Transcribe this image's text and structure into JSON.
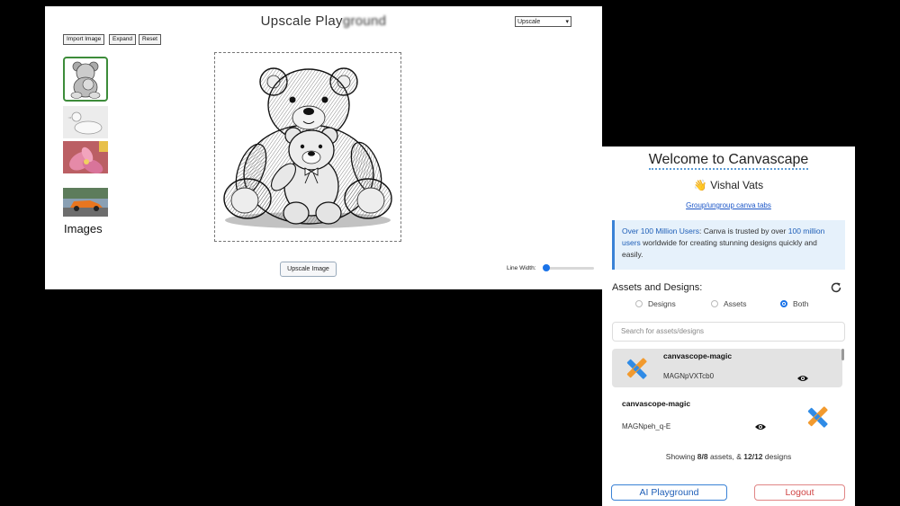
{
  "playground": {
    "title_main": "Upscale Play",
    "title_blur": "ground",
    "mode_select": "Upscale",
    "buttons": {
      "import": "Import Image",
      "expand": "Expand",
      "reset": "Reset"
    },
    "images_label": "Images",
    "upscale_button": "Upscale Image",
    "line_width_label": "Line Width:",
    "line_width_value": 0.0
  },
  "panel": {
    "welcome": "Welcome to Canvascape",
    "user_emoji": "👋",
    "user_name": "Vishal Vats",
    "group_link": "Group/ungroup canva tabs",
    "info": {
      "lead": "Over 100 Million Users",
      "text1": ": Canva is trusted by over ",
      "highlight": "100 million users",
      "text2": " worldwide for creating stunning designs quickly and easily."
    },
    "assets_title": "Assets and Designs:",
    "filters": [
      "Designs",
      "Assets",
      "Both"
    ],
    "selected_filter": "Both",
    "search_placeholder": "Search for assets/designs",
    "items": [
      {
        "name": "canvascope-magic",
        "id": "MAGNpVXTcb0"
      },
      {
        "name": "canvascope-magic",
        "id": "MAGNpeh_q-E"
      }
    ],
    "showing": {
      "prefix": "Showing ",
      "assets": "8/8",
      "mid": " assets, & ",
      "designs": "12/12",
      "suffix": " designs"
    },
    "ai_button": "AI Playground",
    "logout_button": "Logout"
  },
  "colors": {
    "accent_blue": "#1a73e8",
    "selected_thumb_border": "#3d8c3a",
    "logout_red": "#d04444"
  }
}
